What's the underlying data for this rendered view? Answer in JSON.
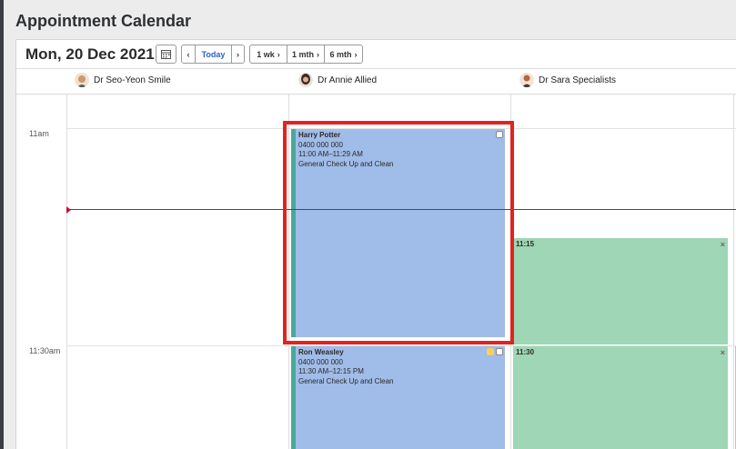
{
  "page_title": "Appointment Calendar",
  "toolbar": {
    "date": "Mon, 20 Dec 2021",
    "prev_label": "‹",
    "today_label": "Today",
    "next_label": "›",
    "week_label": "1 wk",
    "month_label": "1 mth",
    "six_month_label": "6 mth",
    "chevron": "›"
  },
  "providers": [
    {
      "name": "Dr Seo-Yeon Smile",
      "avatar_color": "#c99a6b"
    },
    {
      "name": "Dr Annie Allied",
      "avatar_color": "#3a2a22"
    },
    {
      "name": "Dr Sara Specialists",
      "avatar_color": "#b5683a"
    }
  ],
  "times": [
    "11am",
    "11:30am"
  ],
  "appointments": [
    {
      "name": "Harry Potter",
      "phone": "0400 000 000",
      "time": "11:00 AM–11:29 AM",
      "type": "General Check Up and Clean",
      "color": "#a0bce8",
      "selected": true
    },
    {
      "name": "Ron Weasley",
      "phone": "0400 000 000",
      "time": "11:30 AM–12:15 PM",
      "type": "General Check Up and Clean",
      "color": "#a0bce8"
    }
  ],
  "slots": [
    {
      "time": "11:15",
      "close": "×",
      "color": "#9fd6b5"
    },
    {
      "time": "11:30",
      "close": "×",
      "color": "#9fd6b5"
    }
  ],
  "colors": {
    "selection": "#e3231e",
    "now_line": "#c8102e",
    "accent": "#2a62c9"
  }
}
